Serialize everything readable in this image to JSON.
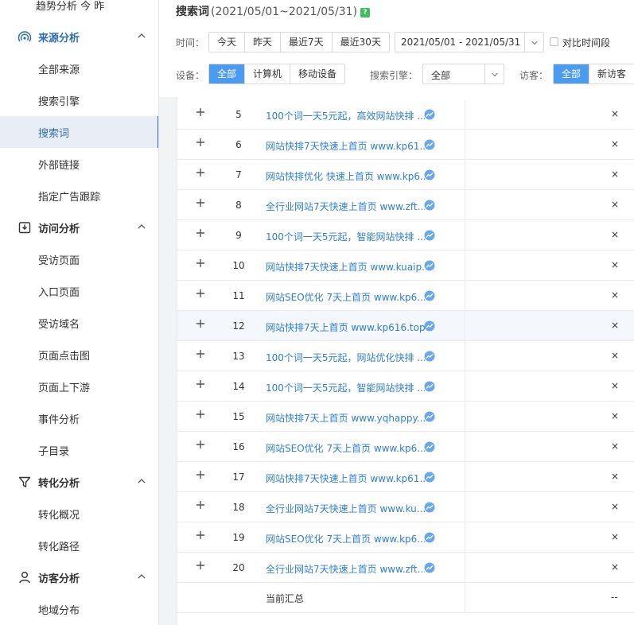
{
  "sidebar": {
    "top_partial": "趋势分析 今 昨",
    "groups": [
      {
        "label": "来源分析",
        "items": [
          "全部来源",
          "搜索引擎",
          "搜索词",
          "外部链接",
          "指定广告跟踪"
        ]
      },
      {
        "label": "访问分析",
        "items": [
          "受访页面",
          "入口页面",
          "受访域名",
          "页面点击图",
          "页面上下游",
          "事件分析",
          "子目录"
        ]
      },
      {
        "label": "转化分析",
        "items": [
          "转化概况",
          "转化路径"
        ]
      },
      {
        "label": "访客分析",
        "items": [
          "地域分布"
        ]
      }
    ],
    "active_item": "搜索词",
    "accent": "#2f6fb0"
  },
  "header": {
    "title": "搜索词",
    "range": "(2021/05/01~2021/05/31)",
    "help": "?"
  },
  "filters": {
    "time_label": "时间：",
    "time_options": [
      "今天",
      "昨天",
      "最近7天",
      "最近30天"
    ],
    "date_range": "2021/05/01 - 2021/05/31",
    "compare_label": "对比时间段",
    "device_label": "设备：",
    "device_options": [
      "全部",
      "计算机",
      "移动设备"
    ],
    "device_selected": "全部",
    "engine_label": "搜索引擎：",
    "engine_value": "全部",
    "visitor_label": "访客：",
    "visitor_options": [
      "全部",
      "新访客"
    ],
    "visitor_selected": "全部",
    "accent": "#4b9cf0"
  },
  "table": {
    "rows": [
      {
        "num": "5",
        "keyword": "100个词一天5元起，高效网站快排 ...",
        "value": "×"
      },
      {
        "num": "6",
        "keyword": "网站快排7天快速上首页 www.kp61...",
        "value": "×"
      },
      {
        "num": "7",
        "keyword": "网站快排优化 快速上首页 www.kp6...",
        "value": "×"
      },
      {
        "num": "8",
        "keyword": "全行业网站7天快速上首页 www.zft...",
        "value": "×"
      },
      {
        "num": "9",
        "keyword": "100个词一天5元起，智能网站快排 ...",
        "value": "×"
      },
      {
        "num": "10",
        "keyword": "网站快排7天快速上首页 www.kuaip...",
        "value": "×"
      },
      {
        "num": "11",
        "keyword": "网站SEO优化 7天上首页 www.kp6...",
        "value": "×"
      },
      {
        "num": "12",
        "keyword": "网站快排7天上首页 www.kp616.top",
        "value": "×"
      },
      {
        "num": "13",
        "keyword": "100个词一天5元起，网站优化快排 ...",
        "value": "×"
      },
      {
        "num": "14",
        "keyword": "100个词一天5元起，智能网站快排 ...",
        "value": "×"
      },
      {
        "num": "15",
        "keyword": "网站快排7天上首页 www.yqhappy....",
        "value": "×"
      },
      {
        "num": "16",
        "keyword": "网站SEO优化 7天上首页 www.kp6...",
        "value": "×"
      },
      {
        "num": "17",
        "keyword": "网站快排7天快速上首页 www.kp61...",
        "value": "×"
      },
      {
        "num": "18",
        "keyword": "全行业网站7天快速上首页 www.ku...",
        "value": "×"
      },
      {
        "num": "19",
        "keyword": "网站SEO优化 7天上首页 www.kp6...",
        "value": "×"
      },
      {
        "num": "20",
        "keyword": "全行业网站7天快速上首页 www.zft...",
        "value": "×"
      }
    ],
    "highlighted_row": "12",
    "summary_label": "当前汇总",
    "summary_value": "--",
    "link_color": "#2f7fd0"
  }
}
